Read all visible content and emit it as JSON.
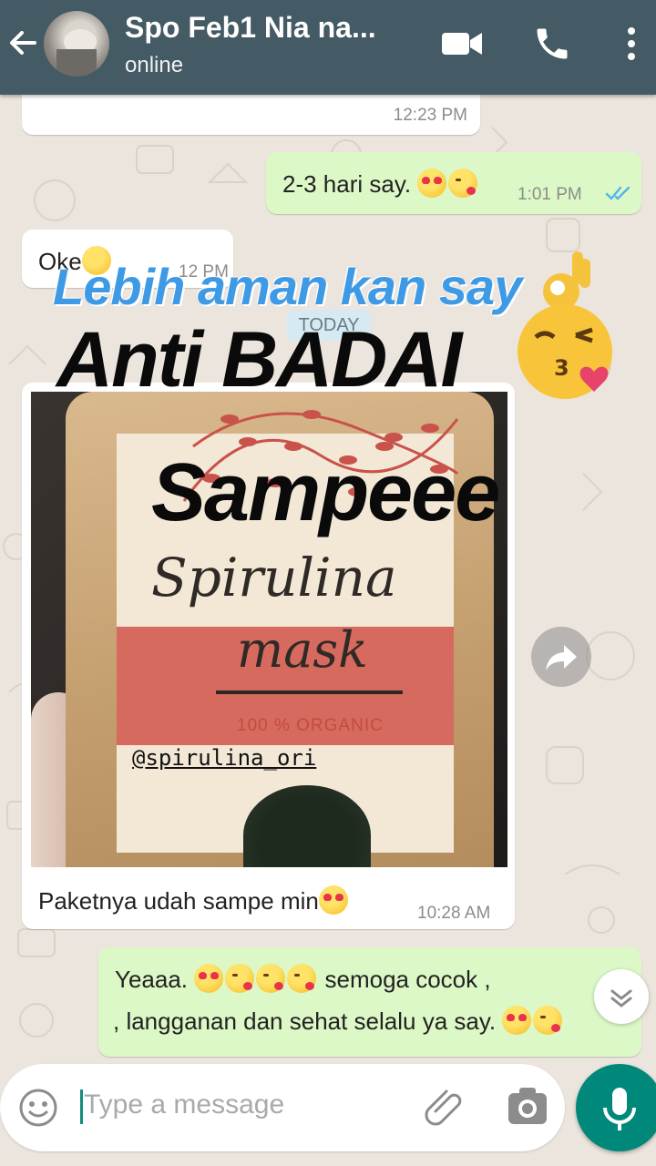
{
  "header": {
    "contact_name": "Spo Feb1 Nia na...",
    "status": "online",
    "icons": [
      "back-arrow-icon",
      "video-call-icon",
      "phone-icon",
      "more-vert-icon"
    ]
  },
  "messages": [
    {
      "direction": "in",
      "text": "",
      "time": "12:23 PM"
    },
    {
      "direction": "out",
      "text": "2-3 hari say.",
      "emojis": [
        "heart-eyes",
        "kiss"
      ],
      "time": "1:01 PM",
      "ticks": "read"
    },
    {
      "direction": "in",
      "text": "Oke",
      "emojis": [
        "smile"
      ],
      "time": "12 PM"
    },
    {
      "direction": "in",
      "type": "image",
      "caption": "Paketnya udah sampe min",
      "emojis": [
        "heart-eyes"
      ],
      "time": "10:28 AM"
    },
    {
      "direction": "out",
      "line1": "Yeaaa.",
      "line1_tail": "semoga cocok ,",
      "line2": ", langganan dan sehat selalu ya say.",
      "time": ""
    }
  ],
  "date_divider": "TODAY",
  "photo": {
    "product_line1": "Spirulina",
    "product_line2": "mask",
    "organic": "100 % ORGANIC"
  },
  "overlay": {
    "line1": "Lebih aman kan say",
    "line2": "Anti BADAI",
    "line3": "Sampeee",
    "handle": "@spirulina_ori"
  },
  "input": {
    "placeholder": "Type a message"
  },
  "colors": {
    "header": "#445a64",
    "outgoing_bubble": "#dcf8c6",
    "incoming_bubble": "#ffffff",
    "accent": "#00897b",
    "read_ticks": "#4fb6ec"
  }
}
